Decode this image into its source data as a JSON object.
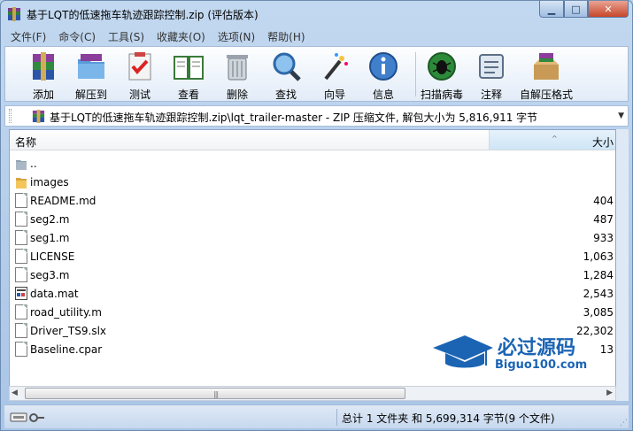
{
  "window": {
    "title": "基于LQT的低速拖车轨迹跟踪控制.zip (评估版本)",
    "minimize_glyph": "▁",
    "maximize_glyph": "□",
    "close_glyph": "✕"
  },
  "menu": [
    "文件(F)",
    "命令(C)",
    "工具(S)",
    "收藏夹(O)",
    "选项(N)",
    "帮助(H)"
  ],
  "toolbar": {
    "buttons": [
      {
        "label": "添加",
        "icon": "add-archive-icon"
      },
      {
        "label": "解压到",
        "icon": "extract-to-icon"
      },
      {
        "label": "测试",
        "icon": "test-icon"
      },
      {
        "label": "查看",
        "icon": "view-icon"
      },
      {
        "label": "删除",
        "icon": "delete-icon"
      },
      {
        "label": "查找",
        "icon": "find-icon"
      },
      {
        "label": "向导",
        "icon": "wizard-icon"
      },
      {
        "label": "信息",
        "icon": "info-icon"
      },
      {
        "label": "扫描病毒",
        "icon": "virus-scan-icon"
      },
      {
        "label": "注释",
        "icon": "comment-icon"
      },
      {
        "label": "自解压格式",
        "icon": "sfx-icon"
      }
    ]
  },
  "path": {
    "text": "基于LQT的低速拖车轨迹跟踪控制.zip\\lqt_trailer-master - ZIP 压缩文件, 解包大小为 5,816,911 字节"
  },
  "columns": {
    "name": "名称",
    "size": "大小"
  },
  "files": [
    {
      "name": "..",
      "size": "",
      "type": "folder-up"
    },
    {
      "name": "images",
      "size": "",
      "type": "folder"
    },
    {
      "name": "README.md",
      "size": "404",
      "type": "doc"
    },
    {
      "name": "seg2.m",
      "size": "487",
      "type": "doc"
    },
    {
      "name": "seg1.m",
      "size": "933",
      "type": "doc"
    },
    {
      "name": "LICENSE",
      "size": "1,063",
      "type": "doc"
    },
    {
      "name": "seg3.m",
      "size": "1,284",
      "type": "doc"
    },
    {
      "name": "data.mat",
      "size": "2,543",
      "type": "mat"
    },
    {
      "name": "road_utility.m",
      "size": "3,085",
      "type": "doc"
    },
    {
      "name": "Driver_TS9.slx",
      "size": "22,302",
      "type": "doc"
    },
    {
      "name": "Baseline.cpar",
      "size": "13",
      "type": "doc"
    }
  ],
  "status": {
    "text": "总计 1 文件夹 和 5,699,314 字节(9 个文件)"
  },
  "watermark": {
    "cn": "必过源码",
    "en": "Biguo100.com"
  },
  "colors": {
    "watermark": "#1b64b4",
    "close_button": "#c7462b",
    "selection": "#cfe5f6"
  }
}
